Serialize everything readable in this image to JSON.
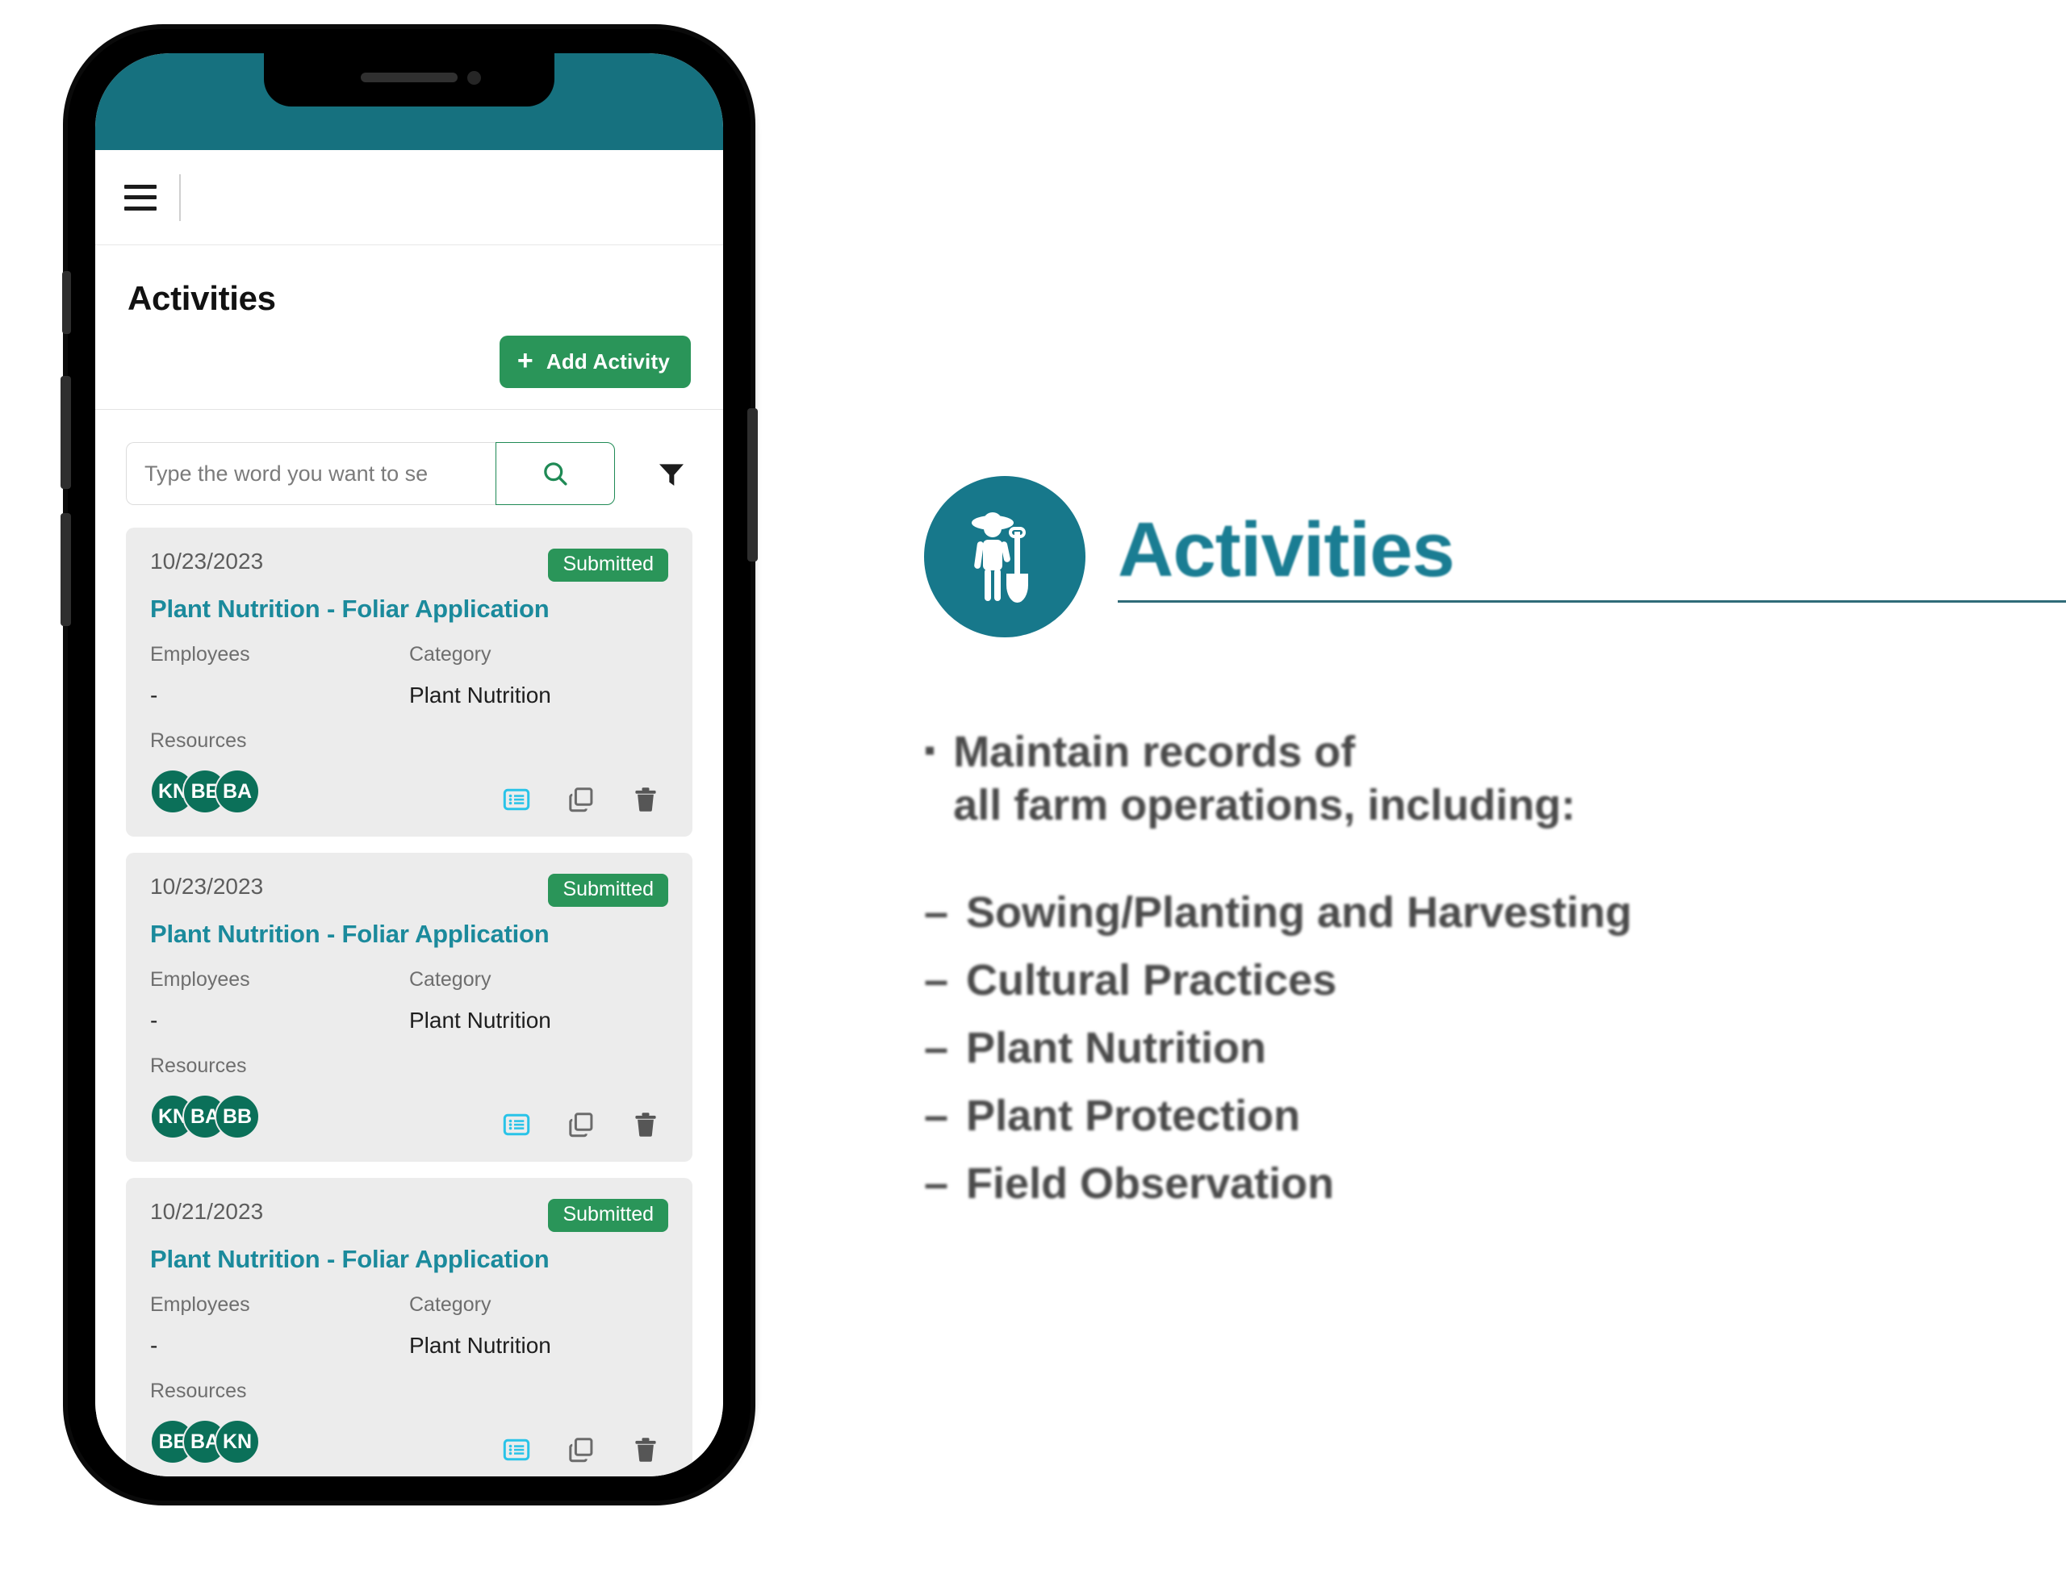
{
  "phone": {
    "status_bar_color": "#16717f",
    "appbar": {
      "menu_icon": "hamburger-menu-icon"
    },
    "page": {
      "title": "Activities",
      "add_button": {
        "label": "Add Activity",
        "icon": "plus-icon",
        "color": "#2a9559"
      },
      "search": {
        "placeholder": "Type the word you want to se",
        "value": "",
        "search_icon": "search-icon",
        "filter_icon": "filter-funnel-icon"
      },
      "labels": {
        "employees": "Employees",
        "category": "Category",
        "resources": "Resources"
      },
      "activities": [
        {
          "date": "10/23/2023",
          "status": "Submitted",
          "title": "Plant Nutrition - Foliar Application",
          "employees": "-",
          "category": "Plant Nutrition",
          "resources": [
            "KN",
            "BE",
            "BA"
          ],
          "actions": [
            "details-list-icon",
            "duplicate-icon",
            "delete-icon"
          ]
        },
        {
          "date": "10/23/2023",
          "status": "Submitted",
          "title": "Plant Nutrition - Foliar Application",
          "employees": "-",
          "category": "Plant Nutrition",
          "resources": [
            "KN",
            "BA",
            "BB"
          ],
          "actions": [
            "details-list-icon",
            "duplicate-icon",
            "delete-icon"
          ]
        },
        {
          "date": "10/21/2023",
          "status": "Submitted",
          "title": "Plant Nutrition - Foliar Application",
          "employees": "-",
          "category": "Plant Nutrition",
          "resources": [
            "BE",
            "BA",
            "KN"
          ],
          "actions": [
            "details-list-icon",
            "duplicate-icon",
            "delete-icon"
          ]
        }
      ]
    }
  },
  "panel": {
    "icon": "farmer-with-shovel-icon",
    "title": "Activities",
    "accent_color": "#1a7d93",
    "bullet_line_1": "Maintain records of",
    "bullet_line_2": "all farm operations, including:",
    "sub_items": [
      "Sowing/Planting and Harvesting",
      "Cultural Practices",
      "Plant Nutrition",
      "Plant Protection",
      "Field Observation"
    ]
  }
}
